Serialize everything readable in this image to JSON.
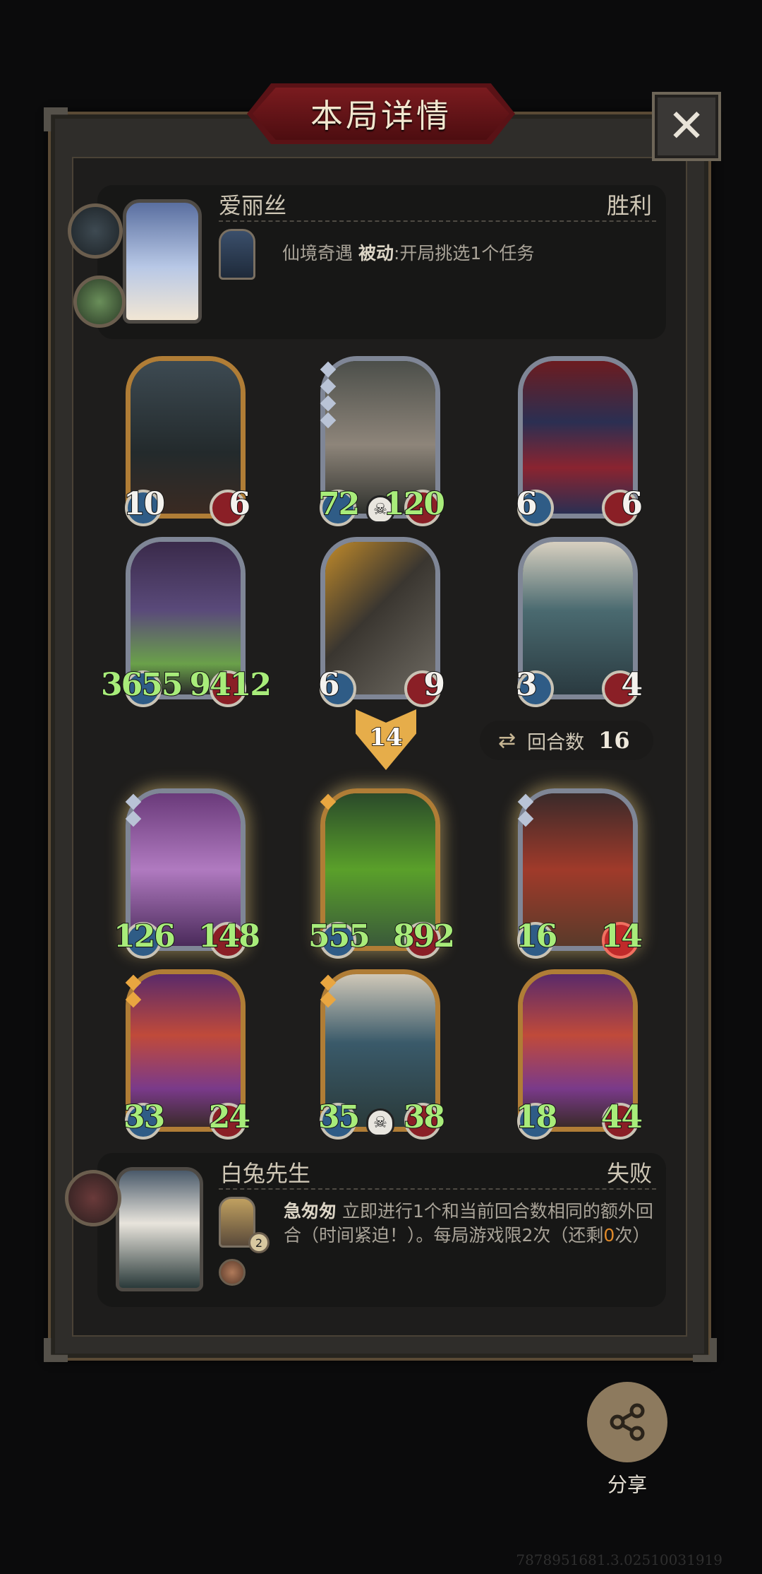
{
  "header": {
    "title": "本局详情",
    "close_icon": "close-icon"
  },
  "top_player": {
    "name": "爱丽丝",
    "result": "胜利",
    "skill_name": "仙境奇遇",
    "skill_type": "被动",
    "skill_desc": ":开局挑选1个任务"
  },
  "opponent_board": [
    {
      "atk": "10",
      "hp": "6",
      "frame": "gold",
      "atk_color": "white",
      "hp_color": "white",
      "gems": 0
    },
    {
      "atk": "72",
      "hp": "120",
      "frame": "silver",
      "atk_color": "green",
      "hp_color": "green",
      "gems": 4,
      "skull": true
    },
    {
      "atk": "6",
      "hp": "6",
      "frame": "silver",
      "atk_color": "white",
      "hp_color": "white",
      "gems": 0
    },
    {
      "atk": "3655",
      "hp": "9412",
      "frame": "silver",
      "atk_color": "green",
      "hp_color": "green",
      "gems": 0
    },
    {
      "atk": "6",
      "hp": "9",
      "frame": "silver",
      "atk_color": "white",
      "hp_color": "white",
      "gems": 0
    },
    {
      "atk": "3",
      "hp": "4",
      "frame": "silver",
      "atk_color": "white",
      "hp_color": "white",
      "gems": 0
    }
  ],
  "middle": {
    "tier_badge": "14",
    "round_label": "回合数",
    "round_value": "16"
  },
  "player_board": [
    {
      "atk": "126",
      "hp": "148",
      "frame": "silver",
      "atk_color": "green",
      "hp_color": "green",
      "gems": 2,
      "glow": true
    },
    {
      "atk": "555",
      "hp": "892",
      "frame": "gold",
      "atk_color": "green",
      "hp_color": "green",
      "gems": 1,
      "glow": true
    },
    {
      "atk": "16",
      "hp": "14",
      "frame": "silver",
      "atk_color": "green",
      "hp_color": "green",
      "gems": 2,
      "glow": true
    },
    {
      "atk": "33",
      "hp": "24",
      "frame": "gold",
      "atk_color": "green",
      "hp_color": "green",
      "gems": 2
    },
    {
      "atk": "35",
      "hp": "38",
      "frame": "gold",
      "atk_color": "green",
      "hp_color": "green",
      "gems": 2,
      "skull": true
    },
    {
      "atk": "18",
      "hp": "44",
      "frame": "gold",
      "atk_color": "green",
      "hp_color": "green",
      "gems": 0
    }
  ],
  "bottom_player": {
    "name": "白兔先生",
    "result": "失败",
    "skill_name": "急匆匆",
    "skill_desc_1": "立即进行1个和当前回合数相同的额外回",
    "skill_desc_2_a": "合（时间紧迫！）。每局游戏限2次（还剩",
    "skill_remaining": "0",
    "skill_desc_2_b": "次）",
    "skill_charge": "2"
  },
  "share": {
    "label": "分享",
    "icon": "share-icon"
  },
  "footer": {
    "version": "7878951681.3.02510031919"
  },
  "colors": {
    "frame_gold": "#b07d36",
    "frame_silver": "#7f8696",
    "buffed_stat": "#a8ec7a",
    "title_red": "#7a1b1f"
  }
}
